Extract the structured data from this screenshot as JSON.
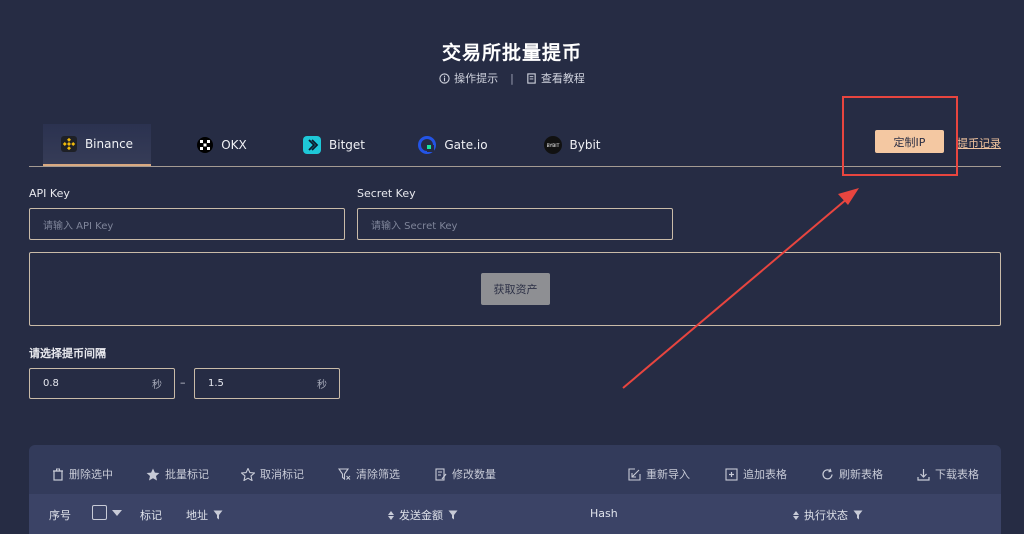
{
  "header": {
    "title": "交易所批量提币",
    "tips_label": "操作提示",
    "separator": "|",
    "tutorial_label": "查看教程"
  },
  "tabs": [
    {
      "label": "Binance",
      "icon": "binance-icon",
      "active": true
    },
    {
      "label": "OKX",
      "icon": "okx-icon",
      "active": false
    },
    {
      "label": "Bitget",
      "icon": "bitget-icon",
      "active": false
    },
    {
      "label": "Gate.io",
      "icon": "gateio-icon",
      "active": false
    },
    {
      "label": "Bybit",
      "icon": "bybit-icon",
      "active": false
    }
  ],
  "actions": {
    "custom_ip": "定制IP",
    "withdraw_record": "提币记录"
  },
  "form": {
    "api_key_label": "API Key",
    "api_key_placeholder": "请输入 API Key",
    "secret_key_label": "Secret Key",
    "secret_key_placeholder": "请输入 Secret Key",
    "get_assets": "获取资产",
    "interval_label": "请选择提币间隔",
    "interval_min": "0.8",
    "interval_max": "1.5",
    "interval_unit": "秒",
    "interval_dash": "–"
  },
  "toolbar": {
    "left": [
      {
        "label": "删除选中",
        "icon": "trash-icon"
      },
      {
        "label": "批量标记",
        "icon": "star-filled-icon"
      },
      {
        "label": "取消标记",
        "icon": "star-outline-icon"
      },
      {
        "label": "清除筛选",
        "icon": "filter-clear-icon"
      },
      {
        "label": "修改数量",
        "icon": "edit-icon"
      }
    ],
    "right": [
      {
        "label": "重新导入",
        "icon": "import-icon"
      },
      {
        "label": "追加表格",
        "icon": "add-table-icon"
      },
      {
        "label": "刷新表格",
        "icon": "refresh-icon"
      },
      {
        "label": "下载表格",
        "icon": "download-icon"
      }
    ]
  },
  "table": {
    "columns": {
      "index": "序号",
      "mark": "标记",
      "address": "地址",
      "amount": "发送金额",
      "hash": "Hash",
      "status": "执行状态"
    }
  },
  "colors": {
    "background": "#262c44",
    "accent": "#f4c8a2",
    "highlight": "#e8453f",
    "panel": "#333b5b"
  }
}
